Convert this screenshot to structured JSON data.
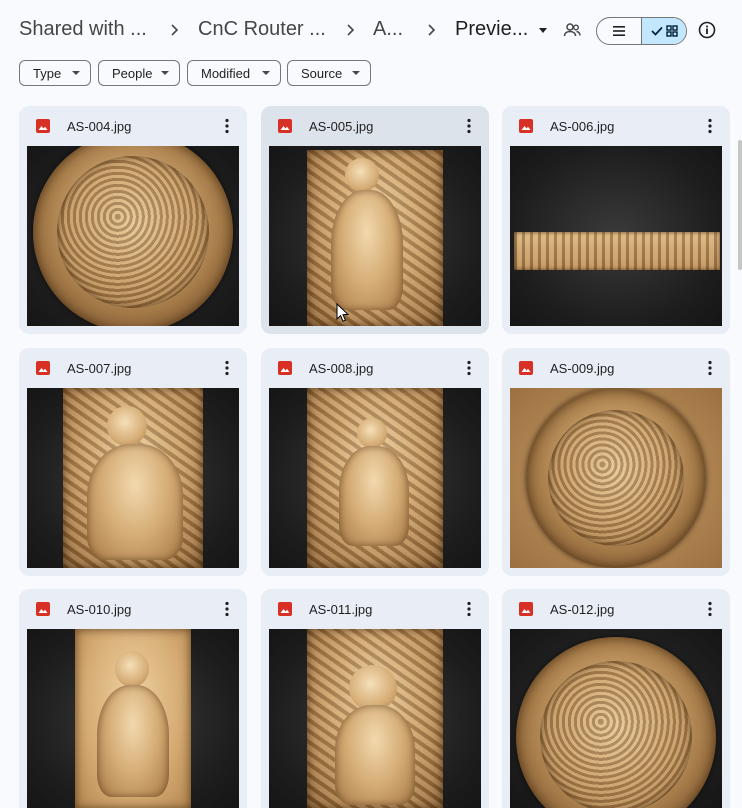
{
  "breadcrumb": {
    "items": [
      "Shared with ...",
      "CnC Router ...",
      "A...",
      "Previe..."
    ]
  },
  "toolbar": {
    "share_icon": "people-icon",
    "list_view_icon": "list-icon",
    "grid_view_icon": "grid-icon",
    "grid_selected_icon": "check-icon",
    "info_icon": "info-icon"
  },
  "filters": [
    {
      "label": "Type"
    },
    {
      "label": "People"
    },
    {
      "label": "Modified"
    },
    {
      "label": "Source"
    }
  ],
  "files": [
    {
      "name": "AS-004.jpg",
      "thumb": "round-dragon-medallion"
    },
    {
      "name": "AS-005.jpg",
      "thumb": "warrior-panel"
    },
    {
      "name": "AS-006.jpg",
      "thumb": "long-strip-panel"
    },
    {
      "name": "AS-007.jpg",
      "thumb": "seated-general-panel"
    },
    {
      "name": "AS-008.jpg",
      "thumb": "deity-with-phoenix-panel"
    },
    {
      "name": "AS-009.jpg",
      "thumb": "dragon-medallion"
    },
    {
      "name": "AS-010.jpg",
      "thumb": "guanyin-panel"
    },
    {
      "name": "AS-011.jpg",
      "thumb": "ganesha-panel"
    },
    {
      "name": "AS-012.jpg",
      "thumb": "dragon-round-openwork"
    }
  ],
  "colors": {
    "background": "#f8fafd",
    "card": "#e9eef6",
    "card_hover": "#dde3ea",
    "selected_toggle": "#c2e7ff",
    "image_file_icon": "#d93025"
  }
}
